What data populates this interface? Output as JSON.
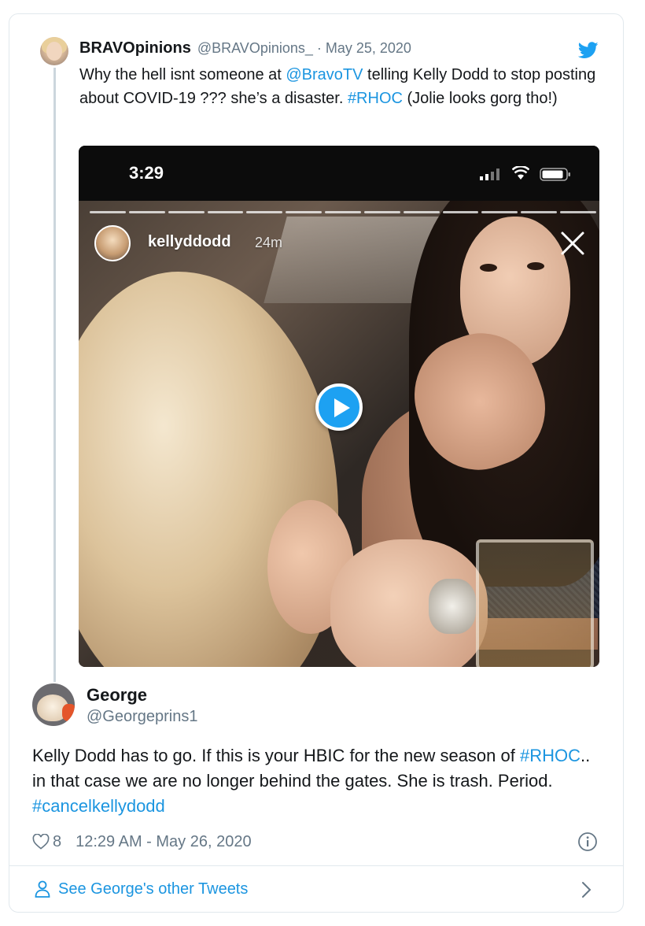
{
  "quoted_tweet": {
    "name": "BRAVOpinions",
    "handle": "@BRAVOpinions_",
    "separator": "·",
    "date": "May 25, 2020",
    "text_before": "Why the hell isnt someone at ",
    "mention": "@BravoTV",
    "text_middle": " telling Kelly Dodd to stop posting about COVID-19 ??? she’s a disaster. ",
    "hashtag": "#RHOC",
    "text_after": " (Jolie looks gorg tho!)"
  },
  "media": {
    "phone_time": "3:29",
    "story_user": "kellyddodd",
    "story_time": "24m",
    "play_icon": "play-icon"
  },
  "tweet": {
    "author_name": "George",
    "author_handle": "@Georgeprins1",
    "text_part1": "Kelly Dodd has to go. If this is your HBIC for the new season of ",
    "hashtag1": "#RHOC",
    "text_part2": ".. in that case we are no longer behind the gates. She is trash. Period. ",
    "hashtag2": "#cancelkellydodd",
    "likes": "8",
    "timestamp": "12:29 AM - May 26, 2020"
  },
  "footer": {
    "link_label": "See George's other Tweets"
  },
  "colors": {
    "link": "#1b95e0",
    "twitter_blue": "#1da1f2",
    "muted": "#657786",
    "border": "#e1e8ed"
  }
}
